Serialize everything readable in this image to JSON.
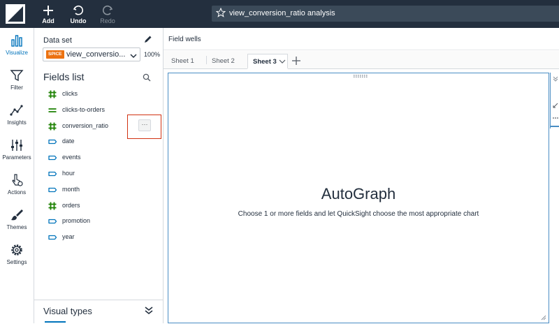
{
  "topbar": {
    "add_label": "Add",
    "undo_label": "Undo",
    "redo_label": "Redo",
    "analysis_title": "view_conversion_ratio analysis"
  },
  "leftnav": {
    "items": [
      {
        "label": "Visualize",
        "icon": "bar-chart-icon",
        "active": true
      },
      {
        "label": "Filter",
        "icon": "funnel-icon"
      },
      {
        "label": "Insights",
        "icon": "insights-icon"
      },
      {
        "label": "Parameters",
        "icon": "sliders-icon"
      },
      {
        "label": "Actions",
        "icon": "pointer-gear-icon"
      },
      {
        "label": "Themes",
        "icon": "brush-icon"
      },
      {
        "label": "Settings",
        "icon": "gear-icon"
      }
    ]
  },
  "dataset": {
    "label": "Data set",
    "badge": "SPICE",
    "name": "view_conversio...",
    "percent": "100%"
  },
  "fields": {
    "title": "Fields list",
    "items": [
      {
        "name": "clicks",
        "type": "measure"
      },
      {
        "name": "clicks-to-orders",
        "type": "calculated"
      },
      {
        "name": "conversion_ratio",
        "type": "measure"
      },
      {
        "name": "date",
        "type": "dimension"
      },
      {
        "name": "events",
        "type": "dimension"
      },
      {
        "name": "hour",
        "type": "dimension"
      },
      {
        "name": "month",
        "type": "dimension"
      },
      {
        "name": "orders",
        "type": "measure"
      },
      {
        "name": "promotion",
        "type": "dimension"
      },
      {
        "name": "year",
        "type": "dimension"
      }
    ],
    "more_label": "···"
  },
  "visual_types": {
    "title": "Visual types"
  },
  "main": {
    "field_wells": "Field wells",
    "sheets": [
      {
        "label": "Sheet 1"
      },
      {
        "label": "Sheet 2"
      },
      {
        "label": "Sheet 3",
        "active": true
      }
    ],
    "autograph_title": "AutoGraph",
    "autograph_subtitle": "Choose 1 or more fields and let QuickSight choose the most appropriate chart"
  },
  "colors": {
    "topbar": "#232f3e",
    "accent": "#0073bb",
    "measure_green": "#1d8102",
    "dimension_blue": "#0073bb",
    "spice_orange": "#ec7211",
    "highlight_red": "#d13212"
  }
}
